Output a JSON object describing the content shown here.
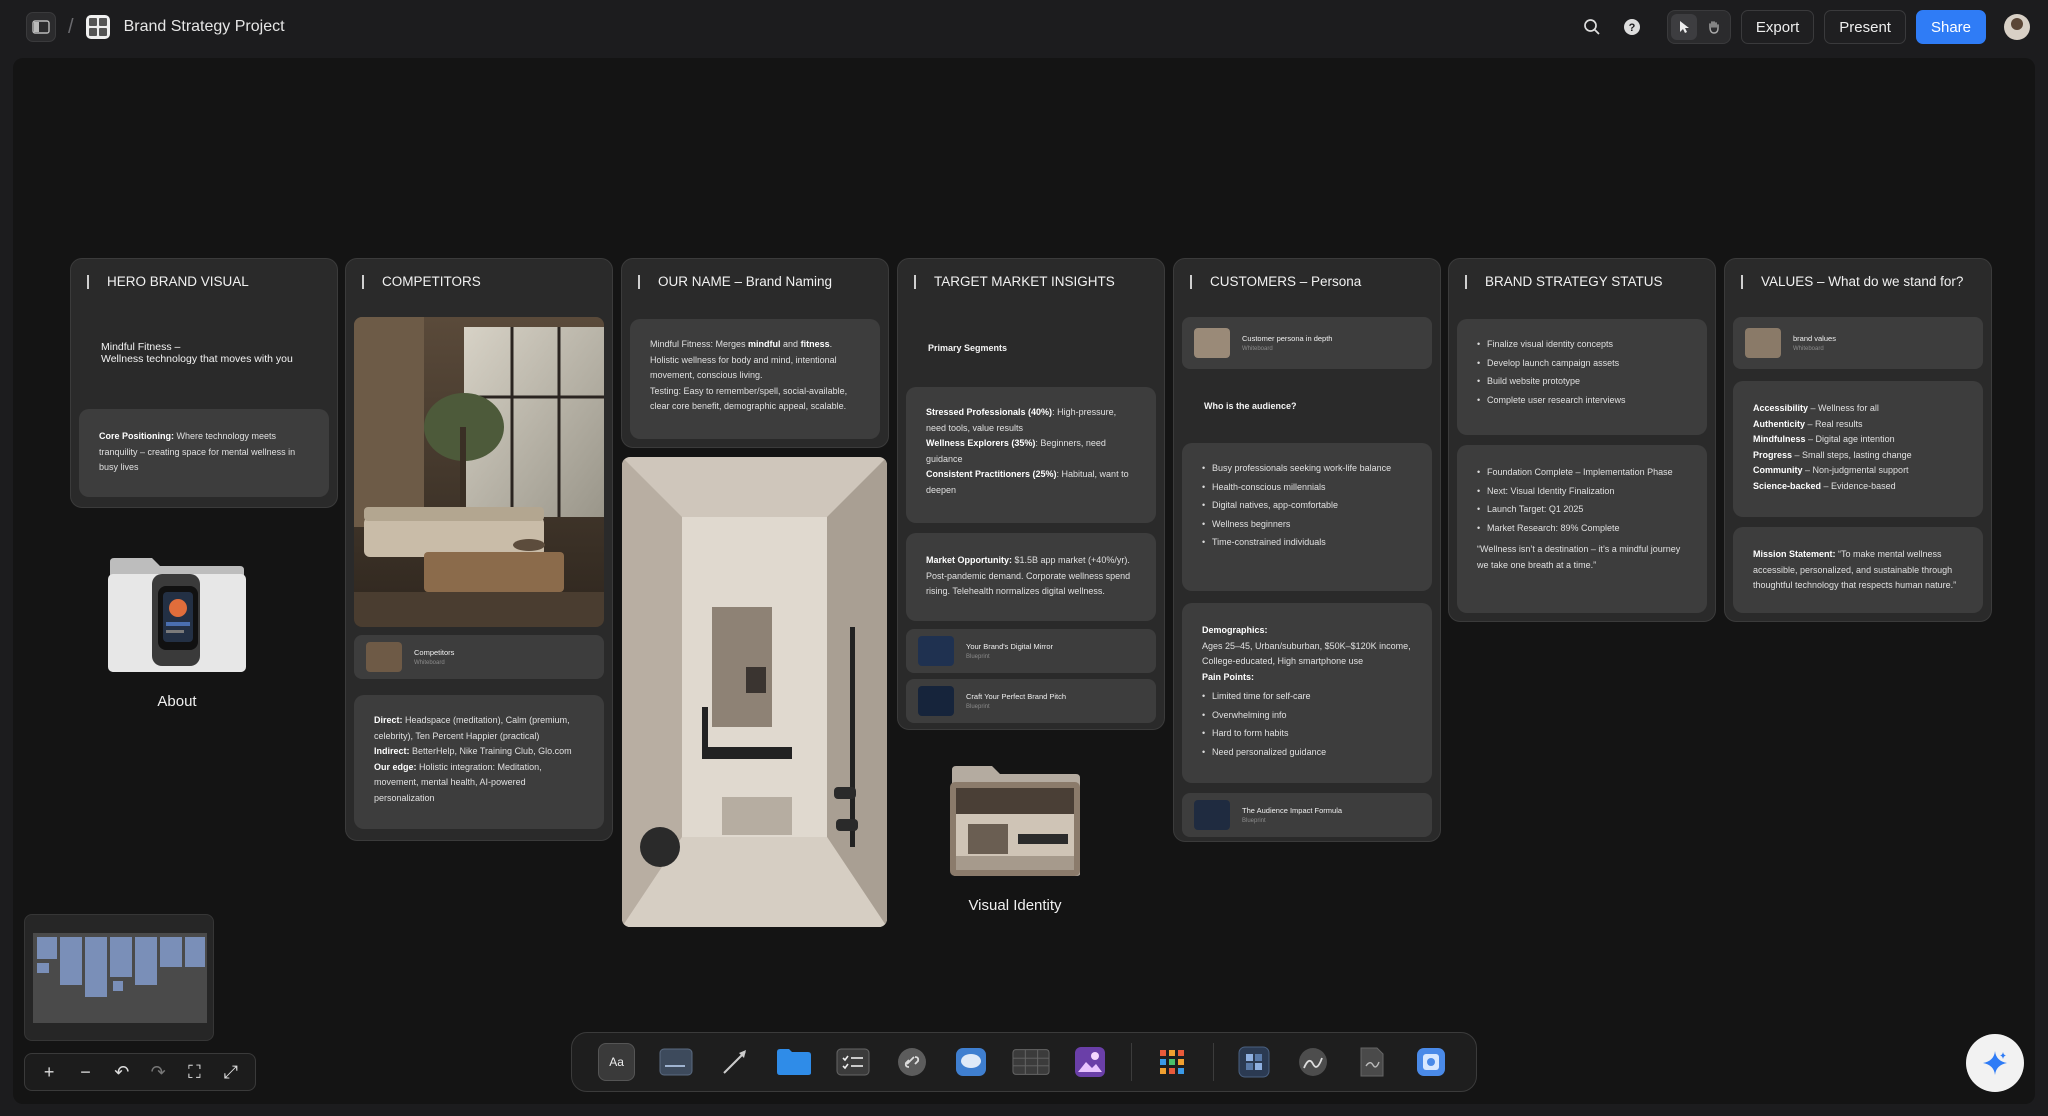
{
  "header": {
    "separator": "/",
    "project_title": "Brand Strategy Project",
    "buttons": {
      "export": "Export",
      "present": "Present",
      "share": "Share"
    }
  },
  "columns": {
    "hero": {
      "title": "HERO BRAND VISUAL",
      "tagline_1": "Mindful Fitness –",
      "tagline_2": "Wellness technology that moves with you",
      "positioning_label": "Core Positioning:",
      "positioning_text": " Where technology meets tranquility – creating space for mental wellness in busy lives"
    },
    "competitors": {
      "title": "COMPETITORS",
      "link_title": "Competitors",
      "link_sub": "Whiteboard",
      "direct_label": "Direct:",
      "direct_text": " Headspace (meditation), Calm (premium, celebrity), Ten Percent Happier (practical)",
      "indirect_label": "Indirect:",
      "indirect_text": " BetterHelp, Nike Training Club, Glo.com",
      "edge_label": "Our edge:",
      "edge_text": " Holistic integration: Meditation, movement, mental health, AI-powered personalization"
    },
    "naming": {
      "title": "OUR NAME – Brand Naming",
      "p1_a": "Mindful Fitness: Merges ",
      "p1_b": "mindful",
      "p1_c": " and ",
      "p1_d": "fitness",
      "p1_e": ".",
      "p2": "Holistic wellness for body and mind, intentional movement, conscious living.",
      "p3": "Testing: Easy to remember/spell, social-available, clear core benefit, demographic appeal, scalable."
    },
    "market": {
      "title": "TARGET MARKET INSIGHTS",
      "primary_segments": "Primary Segments",
      "seg1_label": "Stressed Professionals (40%)",
      "seg1_text": ": High-pressure, need tools, value results",
      "seg2_label": "Wellness Explorers (35%)",
      "seg2_text": ": Beginners, need guidance",
      "seg3_label": "Consistent Practitioners (25%)",
      "seg3_text": ": Habitual, want to deepen",
      "opp_label": "Market Opportunity:",
      "opp_text": " $1.5B app market (+40%/yr). Post-pandemic demand. Corporate wellness spend rising. Telehealth normalizes digital wellness.",
      "link1_title": "Your Brand's Digital Mirror",
      "link1_sub": "Blueprint",
      "link2_title": "Craft Your Perfect Brand Pitch",
      "link2_sub": "Blueprint"
    },
    "persona": {
      "title": "CUSTOMERS – Persona",
      "link_title": "Customer persona in depth",
      "link_sub": "Whiteboard",
      "question": "Who is the audience?",
      "audience": [
        "Busy professionals seeking work-life balance",
        "Health-conscious millennials",
        "Digital natives, app-comfortable",
        "Wellness beginners",
        "Time-constrained individuals"
      ],
      "demographics_label": "Demographics:",
      "demographics_text": "Ages 25–45, Urban/suburban, $50K–$120K income, College-educated, High smartphone use",
      "pain_label": "Pain Points:",
      "pain_points": [
        "Limited time for self-care",
        "Overwhelming info",
        "Hard to form habits",
        "Need personalized guidance"
      ],
      "formula_title": "The Audience Impact Formula",
      "formula_sub": "Blueprint"
    },
    "status": {
      "title": "BRAND STRATEGY STATUS",
      "todo": [
        "Finalize visual identity concepts",
        "Develop launch campaign assets",
        "Build website prototype",
        "Complete user research interviews"
      ],
      "progress": [
        "Foundation Complete – Implementation Phase",
        "Next: Visual Identity Finalization",
        "Launch Target: Q1 2025",
        "Market Research: 89% Complete"
      ],
      "quote": "“Wellness isn’t a destination – it’s a mindful journey we take one breath at a time.”"
    },
    "values": {
      "title": "VALUES – What do we stand for?",
      "link_title": "brand values",
      "link_sub": "Whiteboard",
      "items": [
        {
          "label": "Accessibility",
          "text": " – Wellness for all"
        },
        {
          "label": "Authenticity",
          "text": " – Real results"
        },
        {
          "label": "Mindfulness",
          "text": " – Digital age intention"
        },
        {
          "label": "Progress",
          "text": " – Small steps, lasting change"
        },
        {
          "label": "Community",
          "text": " – Non-judgmental support"
        },
        {
          "label": "Science-backed",
          "text": " – Evidence-based"
        }
      ],
      "mission_label": "Mission Statement:",
      "mission_text": " “To make mental wellness accessible, personalized, and sustainable through thoughtful technology that respects human nature.”"
    }
  },
  "folders": {
    "about": "About",
    "visual_identity": "Visual Identity"
  },
  "dock": {
    "text_tool": "Aa",
    "items": [
      "text-tool",
      "sticky-note-tool",
      "connector-tool",
      "folder-tool",
      "checklist-tool",
      "link-tool",
      "comment-tool",
      "table-tool",
      "image-tool",
      "apps-tool",
      "blueprint-tool",
      "sketch-tool",
      "document-tool",
      "ai-image-tool"
    ]
  },
  "colors": {
    "accent": "#2f7cf6",
    "canvas": "#141414",
    "card": "#3d3d3d",
    "column": "#2a2a2a"
  }
}
